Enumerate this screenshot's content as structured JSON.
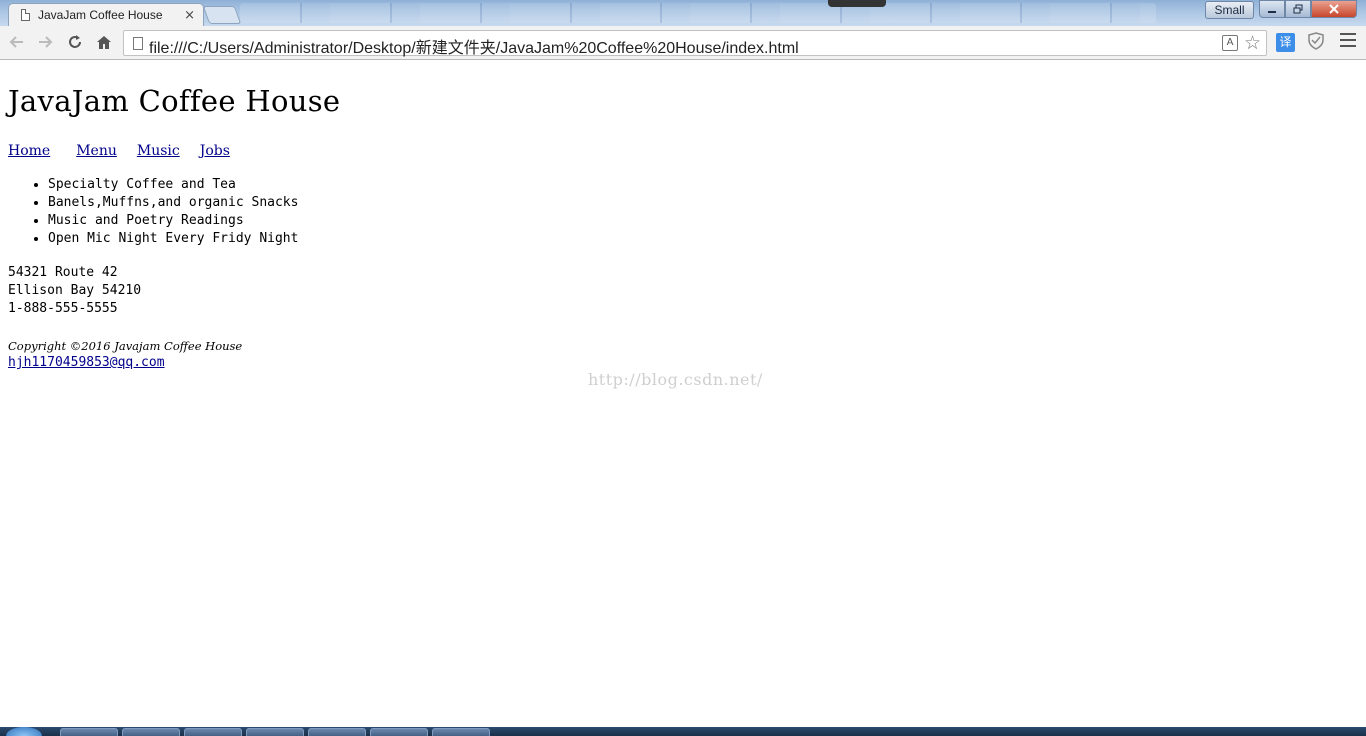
{
  "browser": {
    "tab_title": "JavaJam Coffee House",
    "tab_close_glyph": "×",
    "window_small_label": "Small",
    "url": "file:///C:/Users/Administrator/Desktop/新建文件夹/JavaJam%20Coffee%20House/index.html",
    "translate_ext_label": "译",
    "icons": {
      "back": "back-arrow-icon",
      "forward": "forward-arrow-icon",
      "reload": "reload-icon",
      "home": "home-icon",
      "page": "page-icon",
      "translate": "translate-icon",
      "star": "star-icon",
      "shield": "shield-icon",
      "menu": "menu-icon"
    }
  },
  "page": {
    "title": "JavaJam Coffee House",
    "nav": [
      "Home",
      "Menu",
      "Music",
      "Jobs"
    ],
    "features": [
      "Specialty Coffee and Tea",
      "Banels,Muffns,and organic Snacks",
      "Music and Poetry Readings",
      "Open Mic Night Every Fridy Night"
    ],
    "address": [
      "54321 Route 42",
      "Ellison Bay 54210",
      "1-888-555-5555"
    ],
    "copyright": "Copyright ©2016 Javajam Coffee House",
    "email": "hjh1170459853@qq.com",
    "watermark": "http://blog.csdn.net/"
  }
}
